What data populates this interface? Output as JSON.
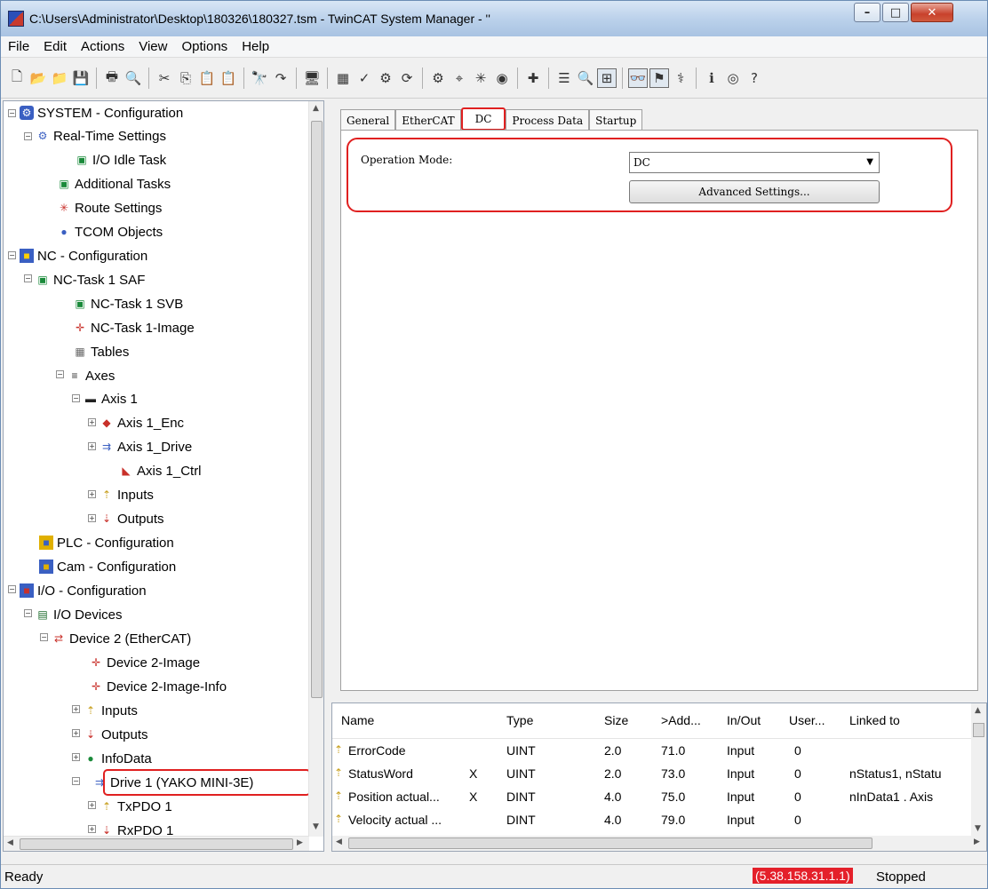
{
  "window": {
    "title": "C:\\Users\\Administrator\\Desktop\\180326\\180327.tsm - TwinCAT System Manager - ''"
  },
  "menu": [
    "File",
    "Edit",
    "Actions",
    "View",
    "Options",
    "Help"
  ],
  "tree": [
    {
      "label": "SYSTEM - Configuration",
      "icon": "system-icon"
    },
    {
      "label": "Real-Time Settings",
      "icon": "realtime-icon"
    },
    {
      "label": "I/O Idle Task",
      "icon": "task-icon"
    },
    {
      "label": "Additional Tasks",
      "icon": "tasks-icon"
    },
    {
      "label": "Route Settings",
      "icon": "route-icon"
    },
    {
      "label": "TCOM Objects",
      "icon": "tcom-icon"
    },
    {
      "label": "NC - Configuration",
      "icon": "nc-icon"
    },
    {
      "label": "NC-Task 1 SAF",
      "icon": "task-icon"
    },
    {
      "label": "NC-Task 1 SVB",
      "icon": "task-icon"
    },
    {
      "label": "NC-Task 1-Image",
      "icon": "image-icon"
    },
    {
      "label": "Tables",
      "icon": "table-icon"
    },
    {
      "label": "Axes",
      "icon": "axes-icon"
    },
    {
      "label": "Axis 1",
      "icon": "axis-icon"
    },
    {
      "label": "Axis 1_Enc",
      "icon": "encoder-icon"
    },
    {
      "label": "Axis 1_Drive",
      "icon": "drive-icon"
    },
    {
      "label": "Axis 1_Ctrl",
      "icon": "controller-icon"
    },
    {
      "label": "Inputs",
      "icon": "inputs-icon"
    },
    {
      "label": "Outputs",
      "icon": "outputs-icon"
    },
    {
      "label": "PLC - Configuration",
      "icon": "plc-icon"
    },
    {
      "label": "Cam - Configuration",
      "icon": "cam-icon"
    },
    {
      "label": "I/O - Configuration",
      "icon": "io-icon"
    },
    {
      "label": "I/O Devices",
      "icon": "devices-icon"
    },
    {
      "label": "Device 2 (EtherCAT)",
      "icon": "ethercat-icon"
    },
    {
      "label": "Device 2-Image",
      "icon": "image-icon"
    },
    {
      "label": "Device 2-Image-Info",
      "icon": "image-icon"
    },
    {
      "label": "Inputs",
      "icon": "inputs-icon"
    },
    {
      "label": "Outputs",
      "icon": "outputs-icon"
    },
    {
      "label": "InfoData",
      "icon": "infodata-icon"
    },
    {
      "label": "Drive 1 (YAKO MINI-3E)",
      "icon": "drive-icon"
    },
    {
      "label": "TxPDO 1",
      "icon": "inputs-icon"
    },
    {
      "label": "RxPDO 1",
      "icon": "outputs-icon"
    }
  ],
  "tabs": [
    "General",
    "EtherCAT",
    "DC",
    "Process Data",
    "Startup"
  ],
  "dc": {
    "operation_mode_label": "Operation Mode:",
    "operation_mode_value": "DC",
    "advanced_button": "Advanced Settings..."
  },
  "vars": {
    "headers": [
      "Name",
      "Type",
      "Size",
      ">Add...",
      "In/Out",
      "User...",
      "Linked to"
    ],
    "rows": [
      {
        "name": "ErrorCode",
        "x": "",
        "type": "UINT",
        "size": "2.0",
        "addr": "71.0",
        "inout": "Input",
        "user": "0",
        "linked": ""
      },
      {
        "name": "StatusWord",
        "x": "X",
        "type": "UINT",
        "size": "2.0",
        "addr": "73.0",
        "inout": "Input",
        "user": "0",
        "linked": "nStatus1, nStatu"
      },
      {
        "name": "Position actual...",
        "x": "X",
        "type": "DINT",
        "size": "4.0",
        "addr": "75.0",
        "inout": "Input",
        "user": "0",
        "linked": "nInData1 . Axis"
      },
      {
        "name": "Velocity actual ...",
        "x": "",
        "type": "DINT",
        "size": "4.0",
        "addr": "79.0",
        "inout": "Input",
        "user": "0",
        "linked": ""
      }
    ]
  },
  "status": {
    "left": "Ready",
    "netid": "(5.38.158.31.1.1)",
    "state": "Stopped"
  }
}
